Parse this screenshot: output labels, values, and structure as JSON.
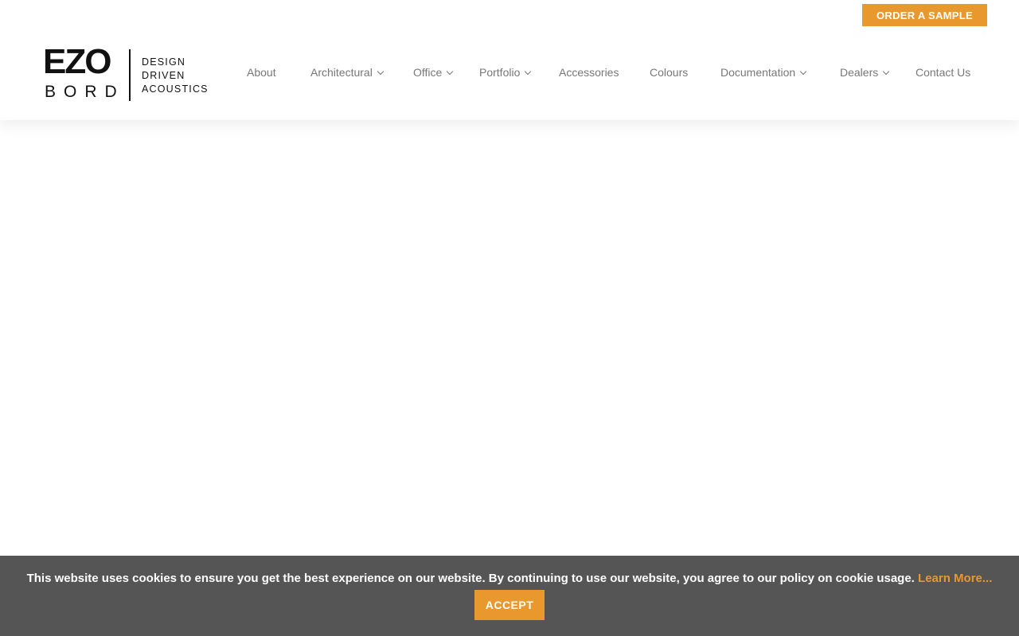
{
  "header": {
    "order_button": "ORDER A SAMPLE",
    "logo": {
      "top": "EZO",
      "bottom": "BORD",
      "tagline": [
        "DESIGN",
        "DRIVEN",
        "ACOUSTICS"
      ]
    }
  },
  "nav": {
    "items": [
      {
        "label": "About",
        "dropdown": false
      },
      {
        "label": "Architectural",
        "dropdown": true
      },
      {
        "label": "Office",
        "dropdown": true
      },
      {
        "label": "Portfolio",
        "dropdown": true
      },
      {
        "label": "Accessories",
        "dropdown": false
      },
      {
        "label": "Colours",
        "dropdown": false
      },
      {
        "label": "Documentation",
        "dropdown": true
      },
      {
        "label": "Dealers",
        "dropdown": true
      },
      {
        "label": "Contact Us",
        "dropdown": false
      }
    ]
  },
  "cookie_bar": {
    "message": "This website uses cookies to ensure you get the best experience on our website. By continuing to use our website, you agree to our policy on cookie usage. ",
    "link": "Learn More...",
    "accept": "ACCEPT"
  },
  "colors": {
    "accent": "#e8982c",
    "nav_text": "#777777",
    "cookie_bg": "#555555"
  }
}
